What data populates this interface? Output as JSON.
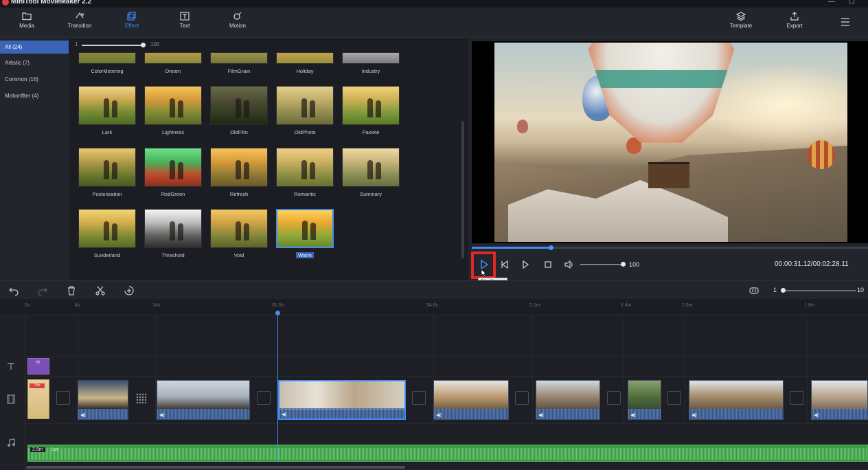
{
  "app": {
    "title": "MiniTool MovieMaker 2.2"
  },
  "toolbar": {
    "items": [
      {
        "label": "Media",
        "icon": "folder-icon"
      },
      {
        "label": "Transition",
        "icon": "transition-icon"
      },
      {
        "label": "Effect",
        "icon": "effect-icon",
        "active": true
      },
      {
        "label": "Text",
        "icon": "text-icon"
      },
      {
        "label": "Motion",
        "icon": "motion-icon"
      }
    ],
    "right": [
      {
        "label": "Template",
        "icon": "layers-icon"
      },
      {
        "label": "Export",
        "icon": "export-icon"
      }
    ]
  },
  "effects_panel": {
    "categories": [
      {
        "label": "All (24)",
        "active": true
      },
      {
        "label": "Artistic (7)"
      },
      {
        "label": "Common (16)"
      },
      {
        "label": "Motionflter (4)"
      }
    ],
    "intensity": {
      "min": "1",
      "max": "100"
    },
    "row0": [
      "ColorMetering",
      "Dream",
      "FilmGrain",
      "Holiday",
      "Industry"
    ],
    "row1": [
      "Lark",
      "Lightness",
      "OldFilm",
      "OldPhoto",
      "Paxiete"
    ],
    "row2": [
      "Posterization",
      "RedGreen",
      "Refresh",
      "Romantic",
      "Summary"
    ],
    "row3": [
      "Sunderland",
      "Threshold",
      "Void",
      "Warm"
    ]
  },
  "player": {
    "volume": "100",
    "timecode": "00:00:31.12/00:02:28.11",
    "tooltip": "Play(Space)",
    "progress_fraction": 0.2
  },
  "timeline": {
    "zoom_min": "1",
    "zoom_max": "10",
    "ruler": [
      "0s",
      "4s",
      "14s",
      "31.5s",
      "54.6s",
      "1.1m",
      "1.4m",
      "1.5m",
      "1.8m"
    ],
    "title_clip_label": "Hi",
    "first_clip_badge": "Title",
    "music": {
      "duration": "2.5m",
      "name": "Lot"
    }
  },
  "colors": {
    "accent": "#3f8cf4",
    "highlight": "#e02828",
    "music": "#3d9a48",
    "title_clip": "#7a4fb8"
  }
}
